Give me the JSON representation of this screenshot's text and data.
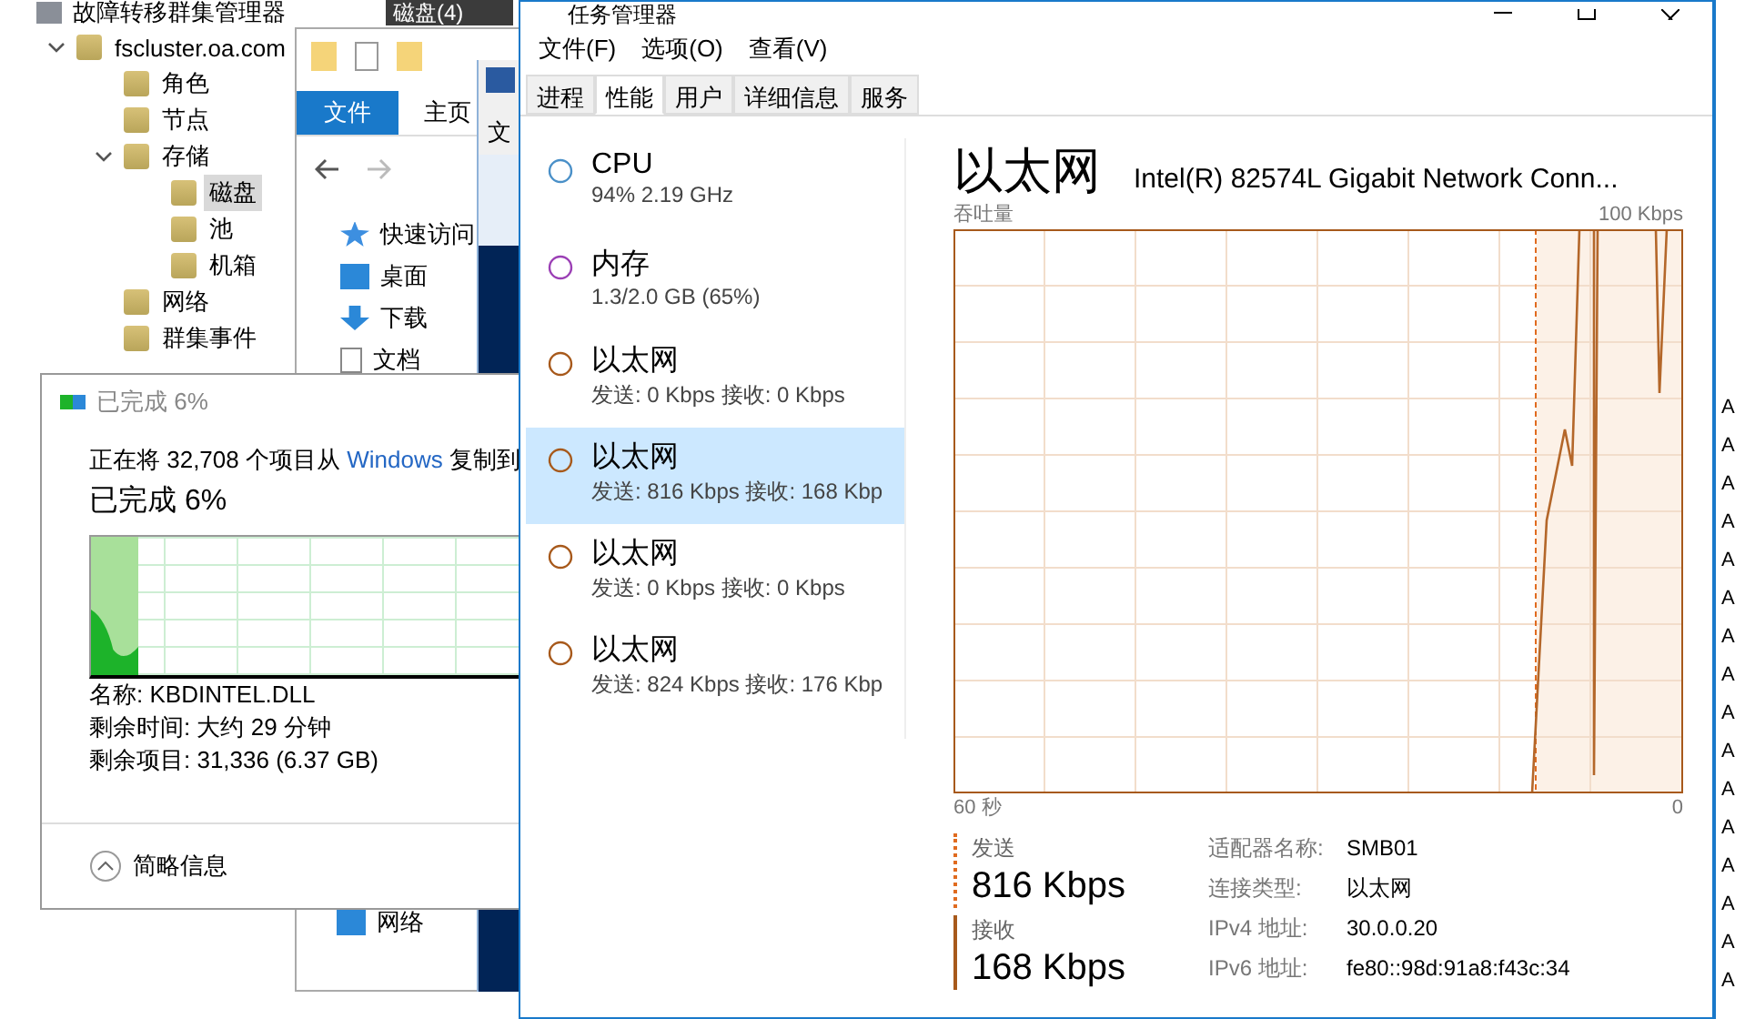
{
  "cluster_manager": {
    "title": "故障转移群集管理器",
    "tab": "磁盘(4)",
    "tree": [
      {
        "label": "fscluster.oa.com",
        "expanded": true,
        "selected": false,
        "children": [
          {
            "label": "角色",
            "selected": false
          },
          {
            "label": "节点",
            "selected": false
          },
          {
            "label": "存储",
            "expanded": true,
            "selected": false,
            "children": [
              {
                "label": "磁盘",
                "selected": true
              },
              {
                "label": "池",
                "selected": false
              },
              {
                "label": "机箱",
                "selected": false
              }
            ]
          },
          {
            "label": "网络",
            "selected": false
          },
          {
            "label": "群集事件",
            "selected": false
          }
        ]
      }
    ]
  },
  "explorer": {
    "file_tab": "文件",
    "home_tab": "主页",
    "nav": [
      "快速访问",
      "桌面",
      "下载",
      "文档"
    ],
    "bottom_nav": "网络"
  },
  "shell_window": {
    "menu": "文"
  },
  "copy_dialog": {
    "title": "已完成 6%",
    "description_start": "正在将 32,708 个项目从",
    "source_link": "Windows",
    "description_end": "复制到",
    "heading": "已完成 6%",
    "level": 0.06,
    "details": [
      "名称: KBDINTEL.DLL",
      "剩余时间: 大约 29 分钟",
      "剩余项目: 31,336 (6.37 GB)"
    ],
    "toggle": "简略信息"
  },
  "task_manager": {
    "title": "任务管理器",
    "menu": [
      "文件(F)",
      "选项(O)",
      "查看(V)"
    ],
    "tabs": [
      {
        "label": "进程",
        "selected": false
      },
      {
        "label": "性能",
        "selected": true
      },
      {
        "label": "用户",
        "selected": false
      },
      {
        "label": "详细信息",
        "selected": false
      },
      {
        "label": "服务",
        "selected": false
      }
    ],
    "resources": [
      {
        "name": "CPU",
        "detail": "94% 2.19 GHz",
        "color": "#4a90c8",
        "selected": false
      },
      {
        "name": "内存",
        "detail": "1.3/2.0 GB (65%)",
        "color": "#9b3fb5",
        "selected": false
      },
      {
        "name": "以太网",
        "detail": "发送: 0 Kbps 接收: 0 Kbps",
        "color": "#a7591b",
        "selected": false
      },
      {
        "name": "以太网",
        "detail": "发送: 816 Kbps 接收: 168 Kbp",
        "color": "#a7591b",
        "selected": true
      },
      {
        "name": "以太网",
        "detail": "发送: 0 Kbps 接收: 0 Kbps",
        "color": "#a7591b",
        "selected": false
      },
      {
        "name": "以太网",
        "detail": "发送: 824 Kbps 接收: 176 Kbp",
        "color": "#a7591b",
        "selected": false
      }
    ],
    "panel": {
      "heading": "以太网",
      "adapter": "Intel(R) 82574L Gigabit Network Conn...",
      "graph_label": "吞吐量",
      "graph_max": "100 Kbps",
      "graph_span": "60 秒",
      "graph_min": "0",
      "send": {
        "label": "发送",
        "value": "816 Kbps"
      },
      "receive": {
        "label": "接收",
        "value": "168 Kbps"
      },
      "properties": [
        {
          "label": "适配器名称:",
          "value": "SMB01"
        },
        {
          "label": "连接类型:",
          "value": "以太网"
        },
        {
          "label": "IPv4 地址:",
          "value": "30.0.0.20"
        },
        {
          "label": "IPv6 地址:",
          "value": "fe80::98d:91a8:f43c:34"
        }
      ]
    }
  },
  "side_window": {
    "items": [
      "A",
      "A",
      "A",
      "A",
      "A",
      "A",
      "A",
      "A",
      "A",
      "A",
      "A",
      "A",
      "A",
      "A",
      "A",
      "A"
    ]
  }
}
